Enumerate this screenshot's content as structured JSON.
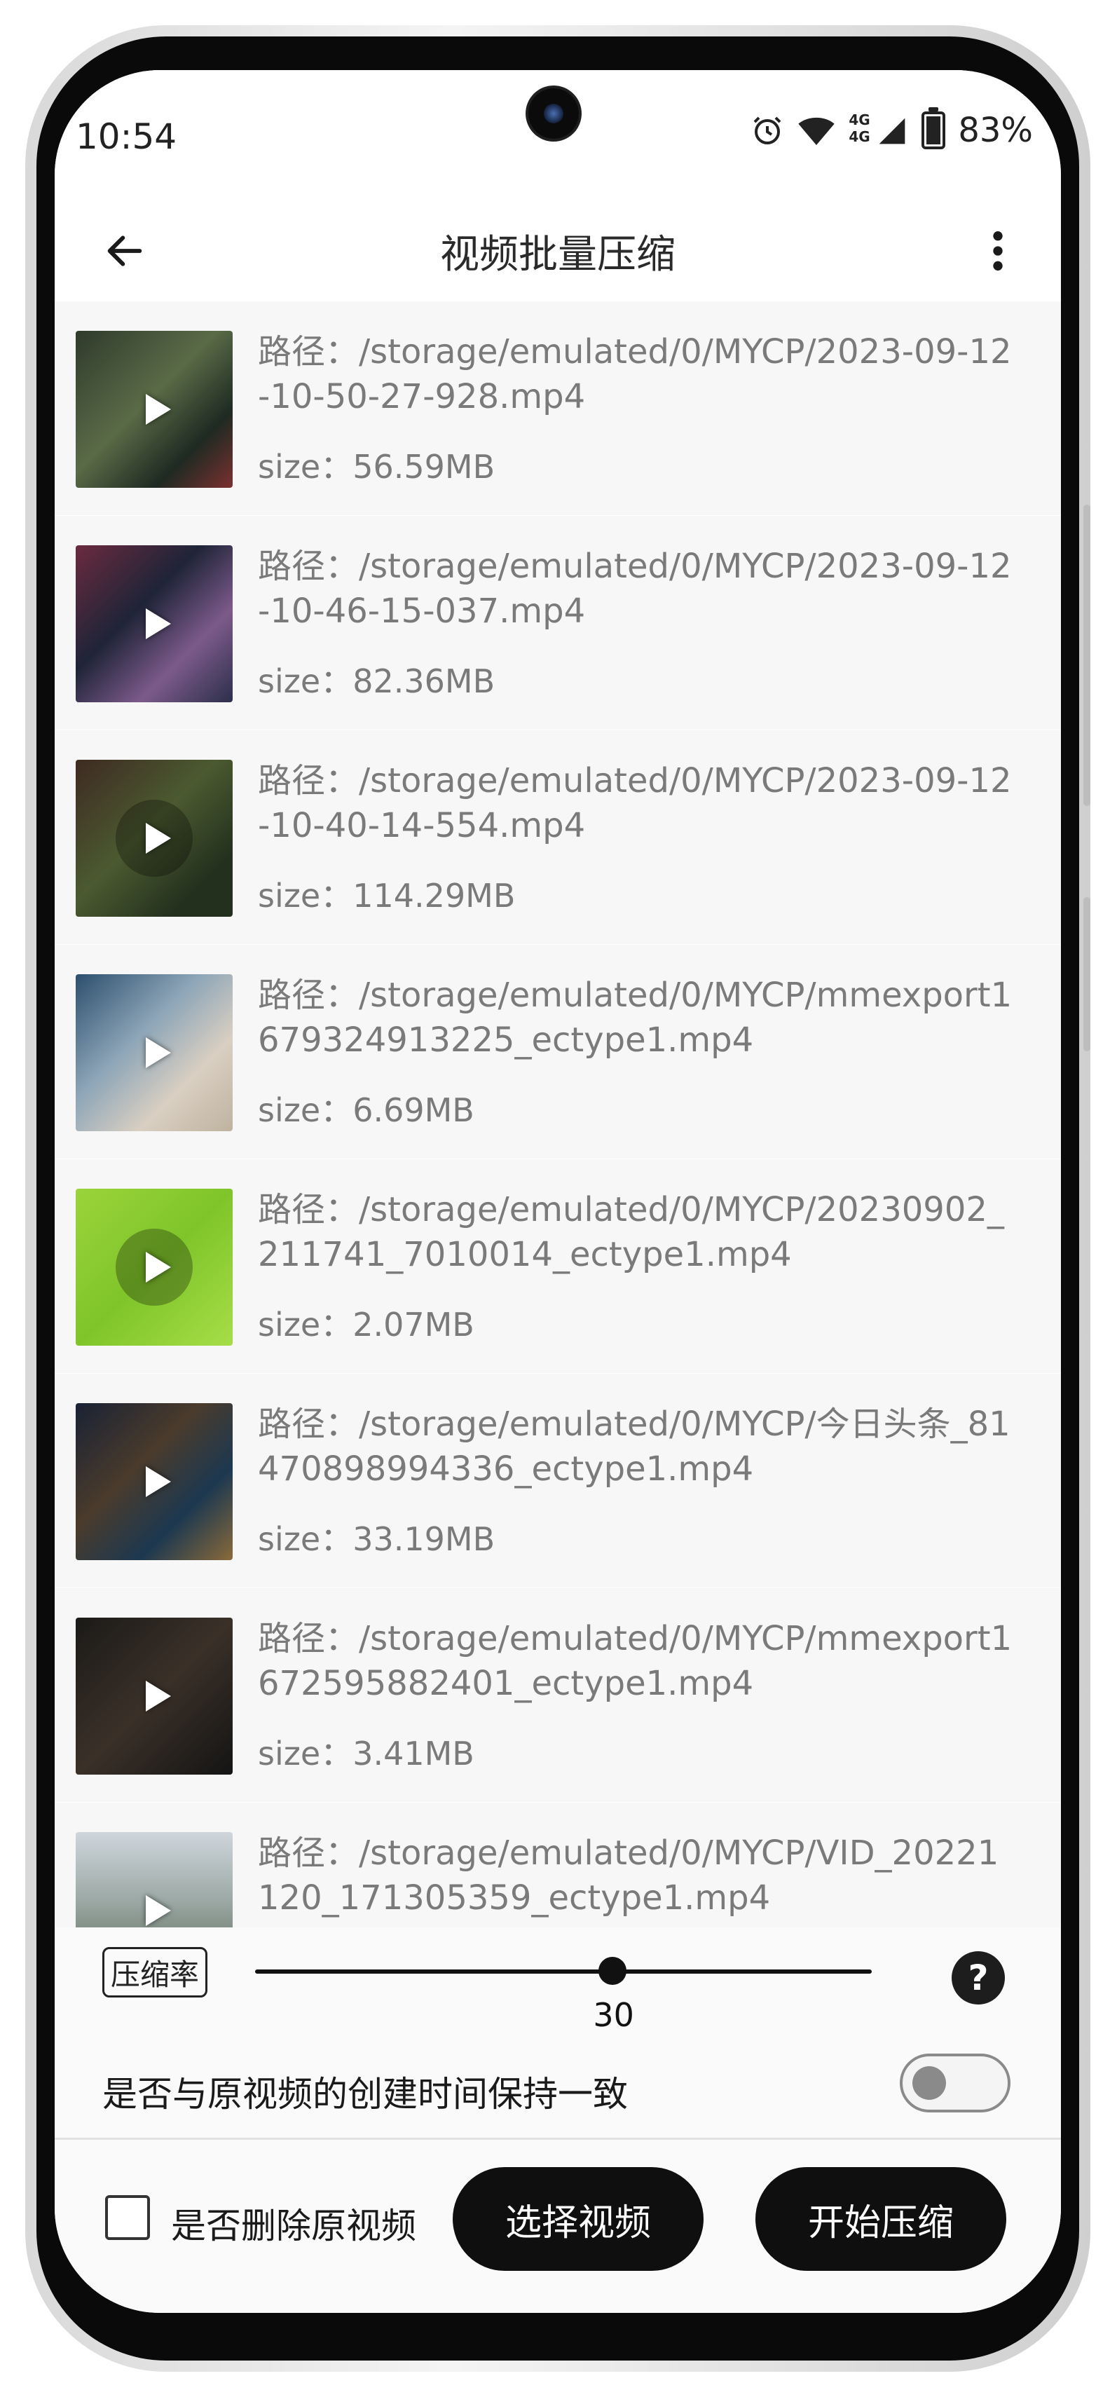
{
  "status_bar": {
    "time": "10:54",
    "network": "4G",
    "network2": "4G",
    "battery": "83%"
  },
  "app_bar": {
    "title": "视频批量压缩"
  },
  "videos": [
    {
      "path": "路径：/storage/emulated/0/MYCP/2023-09-12-10-50-27-928.mp4",
      "size": "size：56.59MB"
    },
    {
      "path": "路径：/storage/emulated/0/MYCP/2023-09-12-10-46-15-037.mp4",
      "size": "size：82.36MB"
    },
    {
      "path": "路径：/storage/emulated/0/MYCP/2023-09-12-10-40-14-554.mp4",
      "size": "size：114.29MB"
    },
    {
      "path": "路径：/storage/emulated/0/MYCP/mmexport1679324913225_ectype1.mp4",
      "size": "size：6.69MB"
    },
    {
      "path": "路径：/storage/emulated/0/MYCP/20230902_211741_7010014_ectype1.mp4",
      "size": "size：2.07MB"
    },
    {
      "path": "路径：/storage/emulated/0/MYCP/今日头条_81470898994336_ectype1.mp4",
      "size": "size：33.19MB"
    },
    {
      "path": "路径：/storage/emulated/0/MYCP/mmexport1672595882401_ectype1.mp4",
      "size": "size：3.41MB"
    },
    {
      "path": "路径：/storage/emulated/0/MYCP/VID_20221120_171305359_ectype1.mp4",
      "size": ""
    }
  ],
  "controls": {
    "compression_label": "压缩率",
    "compression_value": "30",
    "compression_fraction": 0.58,
    "help": "?",
    "keep_time_label": "是否与原视频的创建时间保持一致",
    "keep_time_on": false,
    "delete_original_label": "是否删除原视频",
    "delete_original_checked": false,
    "select_button": "选择视频",
    "start_button": "开始压缩"
  }
}
